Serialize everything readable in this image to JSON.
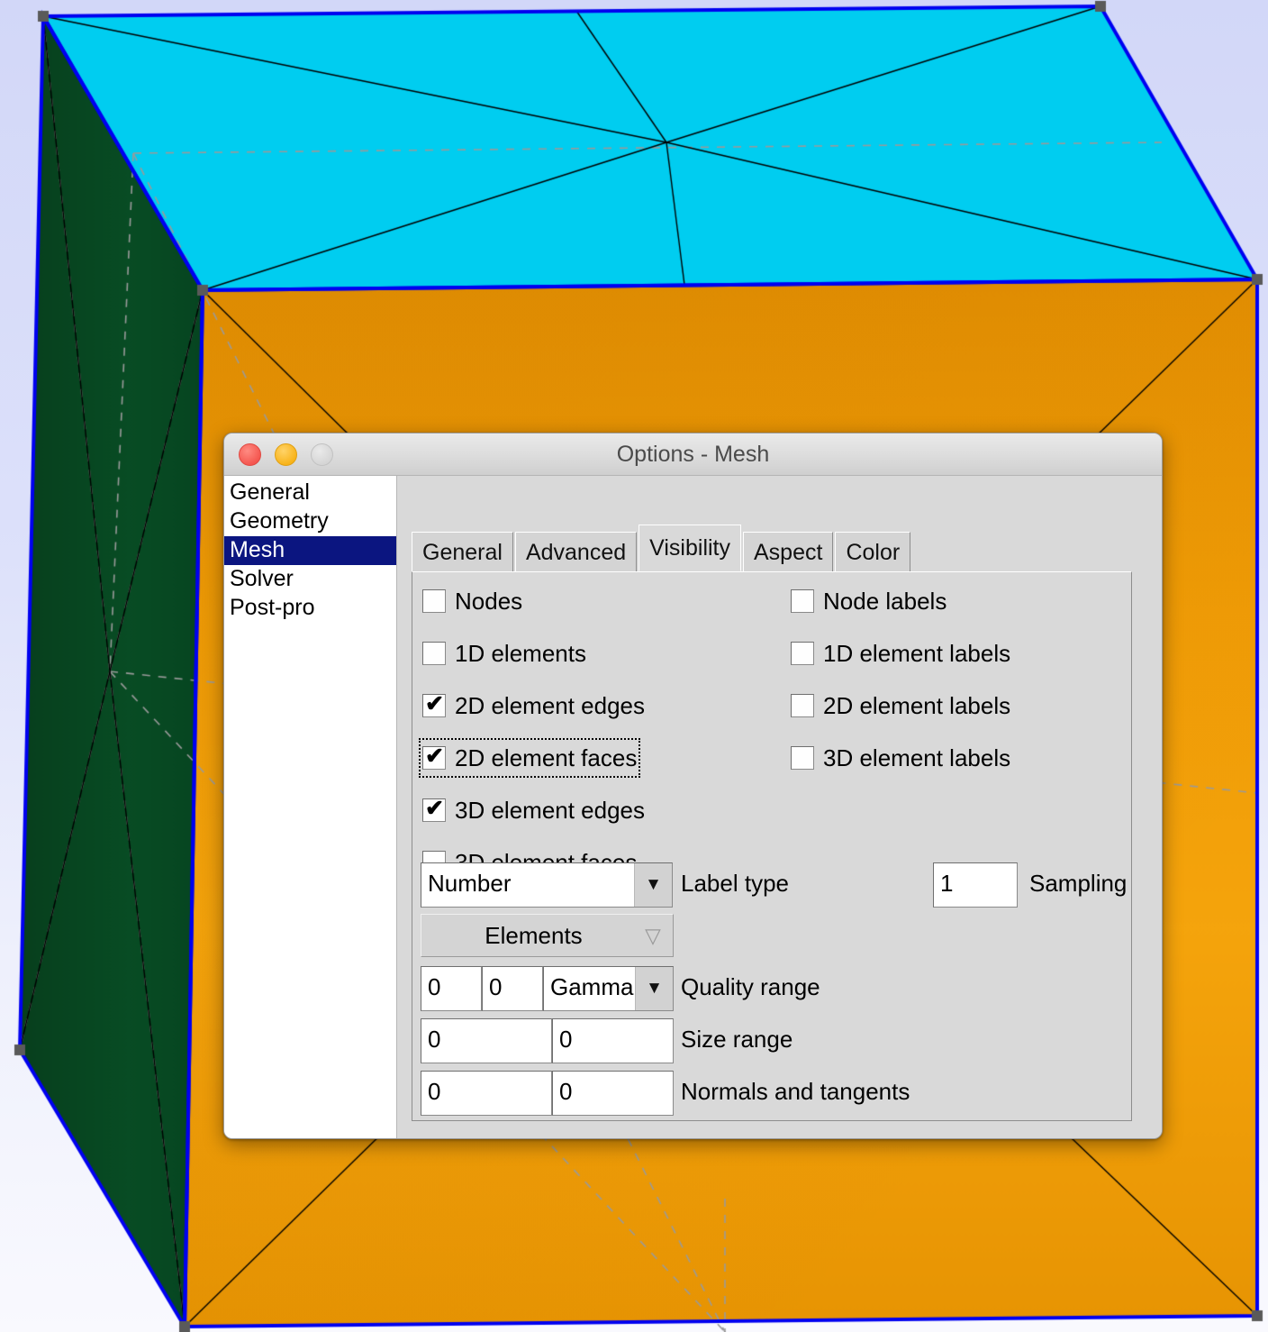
{
  "window": {
    "title": "Options - Mesh",
    "buttons": [
      {
        "name": "close",
        "label": "",
        "color": "#f4564f"
      },
      {
        "name": "minimize",
        "label": "",
        "color": "#f8b319"
      },
      {
        "name": "zoom",
        "label": "",
        "color": "#d5d5d5"
      }
    ]
  },
  "sidebar": {
    "items": [
      {
        "label": "General",
        "selected": false
      },
      {
        "label": "Geometry",
        "selected": false
      },
      {
        "label": "Mesh",
        "selected": true
      },
      {
        "label": "Solver",
        "selected": false
      },
      {
        "label": "Post-pro",
        "selected": false
      }
    ],
    "selected_color": "#0b1580"
  },
  "tabs": [
    {
      "label": "General",
      "active": false
    },
    {
      "label": "Advanced",
      "active": false
    },
    {
      "label": "Visibility",
      "active": true
    },
    {
      "label": "Aspect",
      "active": false
    },
    {
      "label": "Color",
      "active": false
    }
  ],
  "visibility": {
    "left_column": [
      {
        "label": "Nodes",
        "checked": false,
        "focused": false
      },
      {
        "label": "1D elements",
        "checked": false,
        "focused": false
      },
      {
        "label": "2D element edges",
        "checked": true,
        "focused": false
      },
      {
        "label": "2D element faces",
        "checked": true,
        "focused": true
      },
      {
        "label": "3D element edges",
        "checked": true,
        "focused": false
      },
      {
        "label": "3D element faces",
        "checked": false,
        "focused": false
      }
    ],
    "right_column": [
      {
        "label": "Node labels",
        "checked": false
      },
      {
        "label": "1D element labels",
        "checked": false
      },
      {
        "label": "2D element labels",
        "checked": false
      },
      {
        "label": "3D element labels",
        "checked": false
      }
    ],
    "label_type": {
      "value": "Number",
      "label": "Label type"
    },
    "sampling": {
      "value": "1",
      "label": "Sampling"
    },
    "elements_button": {
      "label": "Elements",
      "icon": "▽"
    },
    "quality_range": {
      "min": "0",
      "max": "0",
      "metric": "Gamma",
      "label": "Quality range"
    },
    "size_range": {
      "min": "0",
      "max": "0",
      "label": "Size range"
    },
    "normals_tangents": {
      "normals": "0",
      "tangents": "0",
      "label": "Normals and tangents"
    }
  },
  "scene": {
    "type": "3d-mesh-cube",
    "background_top": "#d2d7f8",
    "background_bottom": "#f9f9fe",
    "faces": [
      {
        "name": "top",
        "color": "#00cdf0"
      },
      {
        "name": "left",
        "color": "#084a22"
      },
      {
        "name": "front",
        "color": "#ef9b06"
      }
    ],
    "geometry_edge_color": "#0000f0",
    "mesh_edge_color": "#000000",
    "hidden_line_color": "#9a9a9a",
    "vertex_marker_color": "#5a5a5a"
  }
}
